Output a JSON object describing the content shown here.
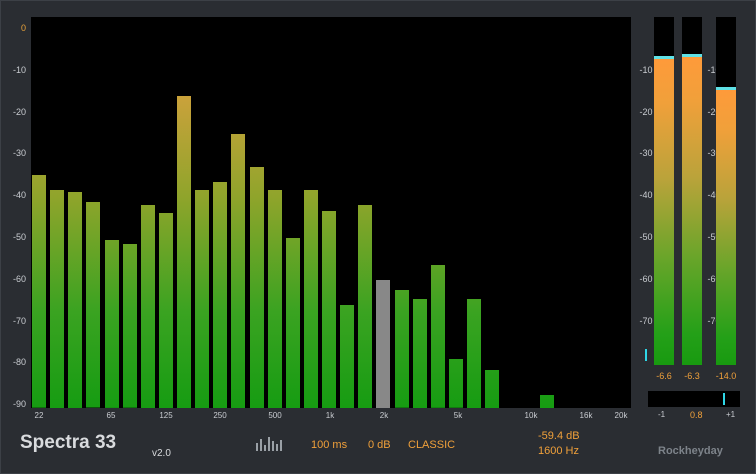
{
  "app": {
    "title": "Spectra 33",
    "version": "v2.0",
    "brand": "Rockheyday"
  },
  "yaxis": [
    "0",
    "-10",
    "-20",
    "-30",
    "-40",
    "-50",
    "-60",
    "-70",
    "-80",
    "-90"
  ],
  "xaxis": [
    "22",
    "65",
    "125",
    "250",
    "500",
    "1k",
    "2k",
    "5k",
    "10k",
    "16k",
    "20k"
  ],
  "bars_db": [
    -35,
    -38.5,
    -39,
    -41.5,
    -50.5,
    -51.5,
    -42,
    -44,
    -16,
    -38.5,
    -36.5,
    -25,
    -33,
    -38.5,
    -50,
    -38.5,
    -43.5,
    -66,
    -42,
    -60,
    -62.5,
    -64.5,
    -56.5,
    -79,
    -64.5,
    -81.5,
    null,
    null,
    -87.5,
    null,
    null,
    null,
    null
  ],
  "highlight_bar": 19,
  "meters": {
    "scale": [
      "-10",
      "-20",
      "-30",
      "-40",
      "-50",
      "-60",
      "-70"
    ],
    "values": [
      "-6.6",
      "-6.3",
      "-14.0"
    ],
    "levels_db": [
      -6.6,
      -6.3,
      -14.0
    ]
  },
  "correlation": {
    "min_label": "-1",
    "value": "0.8",
    "max_label": "+1",
    "level": 0.8
  },
  "controls": {
    "spectrum_icon": "spectrum-icon",
    "time": "100 ms",
    "gain": "0 dB",
    "mode": "CLASSIC"
  },
  "readout": {
    "db": "-59.4 dB",
    "hz": "1600 Hz"
  },
  "colors": {
    "accent": "#f0a03a",
    "bar_highlight": "#888888",
    "peak": "#5fe1e6"
  }
}
